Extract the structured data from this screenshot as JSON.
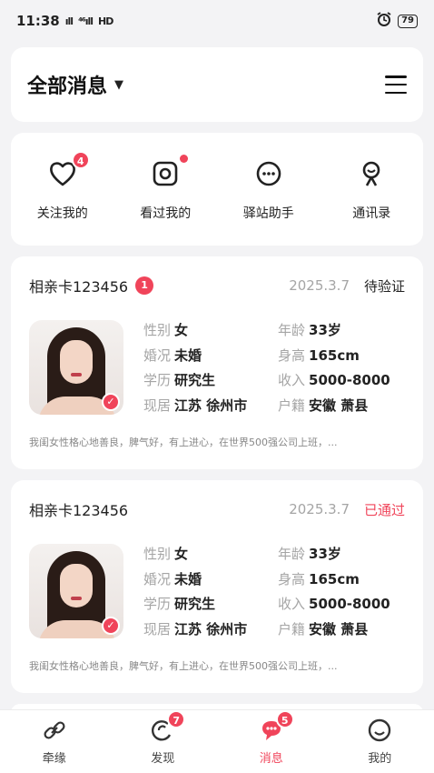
{
  "status_bar": {
    "time": "11:38",
    "signal_text": "4Gill",
    "signal1": "ıll",
    "signal2": "⁴⁶ıll",
    "network": "HD",
    "battery": "79"
  },
  "header": {
    "title": "全部消息",
    "caret": "▼"
  },
  "quick": [
    {
      "label": "关注我的",
      "badge": "4"
    },
    {
      "label": "看过我的"
    },
    {
      "label": "驿站助手"
    },
    {
      "label": "通讯录"
    }
  ],
  "cards": [
    {
      "title": "相亲卡123456",
      "badge": "1",
      "date": "2025.3.7",
      "status": "待验证",
      "status_color": "#222222",
      "fields": [
        {
          "k": "性别",
          "v": "女"
        },
        {
          "k": "年龄",
          "v": "33岁"
        },
        {
          "k": "婚况",
          "v": "未婚"
        },
        {
          "k": "身高",
          "v": "165cm"
        },
        {
          "k": "学历",
          "v": "研究生"
        },
        {
          "k": "收入",
          "v": "5000-8000"
        },
        {
          "k": "现居",
          "v": "江苏 徐州市"
        },
        {
          "k": "户籍",
          "v": "安徽 萧县"
        }
      ],
      "desc": "我闺女性格心地善良，脾气好，有上进心，在世界500强公司上班，..."
    },
    {
      "title": "相亲卡123456",
      "date": "2025.3.7",
      "status": "已通过",
      "status_color": "#f0445a",
      "fields": [
        {
          "k": "性别",
          "v": "女"
        },
        {
          "k": "年龄",
          "v": "33岁"
        },
        {
          "k": "婚况",
          "v": "未婚"
        },
        {
          "k": "身高",
          "v": "165cm"
        },
        {
          "k": "学历",
          "v": "研究生"
        },
        {
          "k": "收入",
          "v": "5000-8000"
        },
        {
          "k": "现居",
          "v": "江苏 徐州市"
        },
        {
          "k": "户籍",
          "v": "安徽 萧县"
        }
      ],
      "desc": "我闺女性格心地善良，脾气好，有上进心，在世界500强公司上班，..."
    }
  ],
  "tabbar": [
    {
      "label": "牵缘",
      "icon": "link-icon"
    },
    {
      "label": "发现",
      "icon": "discover-icon",
      "badge": "7"
    },
    {
      "label": "消息",
      "icon": "message-icon",
      "badge": "5",
      "active": true
    },
    {
      "label": "我的",
      "icon": "profile-icon"
    }
  ],
  "colors": {
    "accent": "#f0445a",
    "background": "#f3f3f5",
    "muted": "#a5a5a5"
  }
}
